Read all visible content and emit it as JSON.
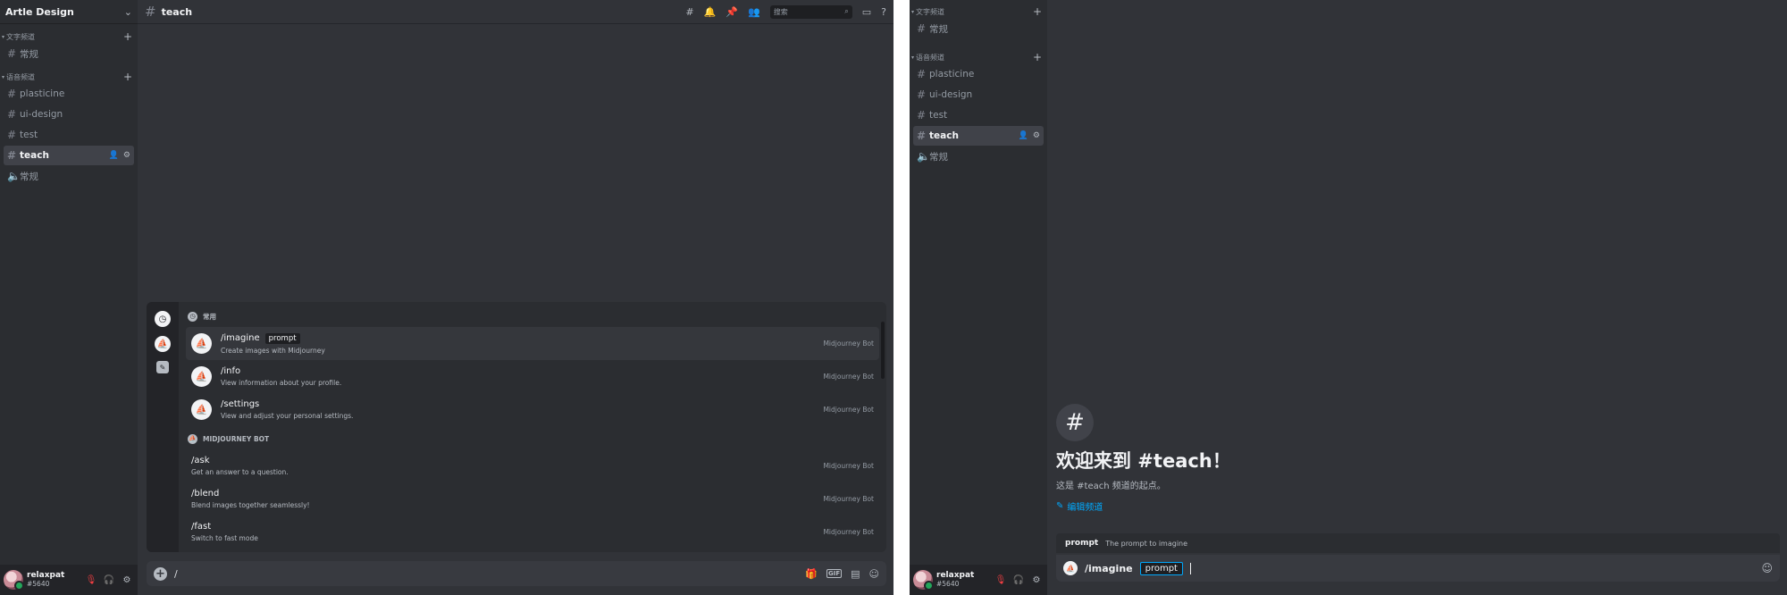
{
  "left": {
    "guild_name": "Artle Design",
    "text_category": "文字频道",
    "text_channels": [
      {
        "name": "常规"
      }
    ],
    "voice_category": "语音频道",
    "voice_channels": [
      {
        "name": "plasticine"
      },
      {
        "name": "ui-design"
      },
      {
        "name": "test"
      },
      {
        "name": "teach"
      },
      {
        "name": "常规"
      }
    ],
    "channel_title": "teach",
    "search_placeholder": "搜索",
    "user": {
      "name": "relaxpat",
      "tag": "#5640"
    },
    "autocomplete": {
      "section_frequent": "常用",
      "frequent": [
        {
          "name": "/imagine",
          "option": "prompt",
          "desc": "Create images with Midjourney",
          "source": "Midjourney Bot"
        },
        {
          "name": "/info",
          "option": "",
          "desc": "View information about your profile.",
          "source": "Midjourney Bot"
        },
        {
          "name": "/settings",
          "option": "",
          "desc": "View and adjust your personal settings.",
          "source": "Midjourney Bot"
        }
      ],
      "section_bot": "MIDJOURNEY BOT",
      "bot": [
        {
          "name": "/ask",
          "desc": "Get an answer to a question.",
          "source": "Midjourney Bot"
        },
        {
          "name": "/blend",
          "desc": "Blend images together seamlessly!",
          "source": "Midjourney Bot"
        },
        {
          "name": "/fast",
          "desc": "Switch to fast mode",
          "source": "Midjourney Bot"
        }
      ]
    },
    "composer_text": "/"
  },
  "right": {
    "text_category": "文字频道",
    "text_channels": [
      {
        "name": "常规"
      }
    ],
    "voice_category": "语音频道",
    "voice_channels": [
      {
        "name": "plasticine"
      },
      {
        "name": "ui-design"
      },
      {
        "name": "test"
      },
      {
        "name": "teach"
      },
      {
        "name": "常规"
      }
    ],
    "user": {
      "name": "relaxpat",
      "tag": "#5640"
    },
    "welcome_title": "欢迎来到 #teach！",
    "welcome_sub": "这是 #teach 频道的起点。",
    "edit_channel": "编辑频道",
    "option_hint": {
      "name": "prompt",
      "desc": "The prompt to imagine"
    },
    "composer": {
      "command": "/imagine",
      "option": "prompt"
    }
  },
  "colors": {
    "accent": "#00a8fc",
    "online": "#23a55a",
    "muted": "#f23f43"
  }
}
